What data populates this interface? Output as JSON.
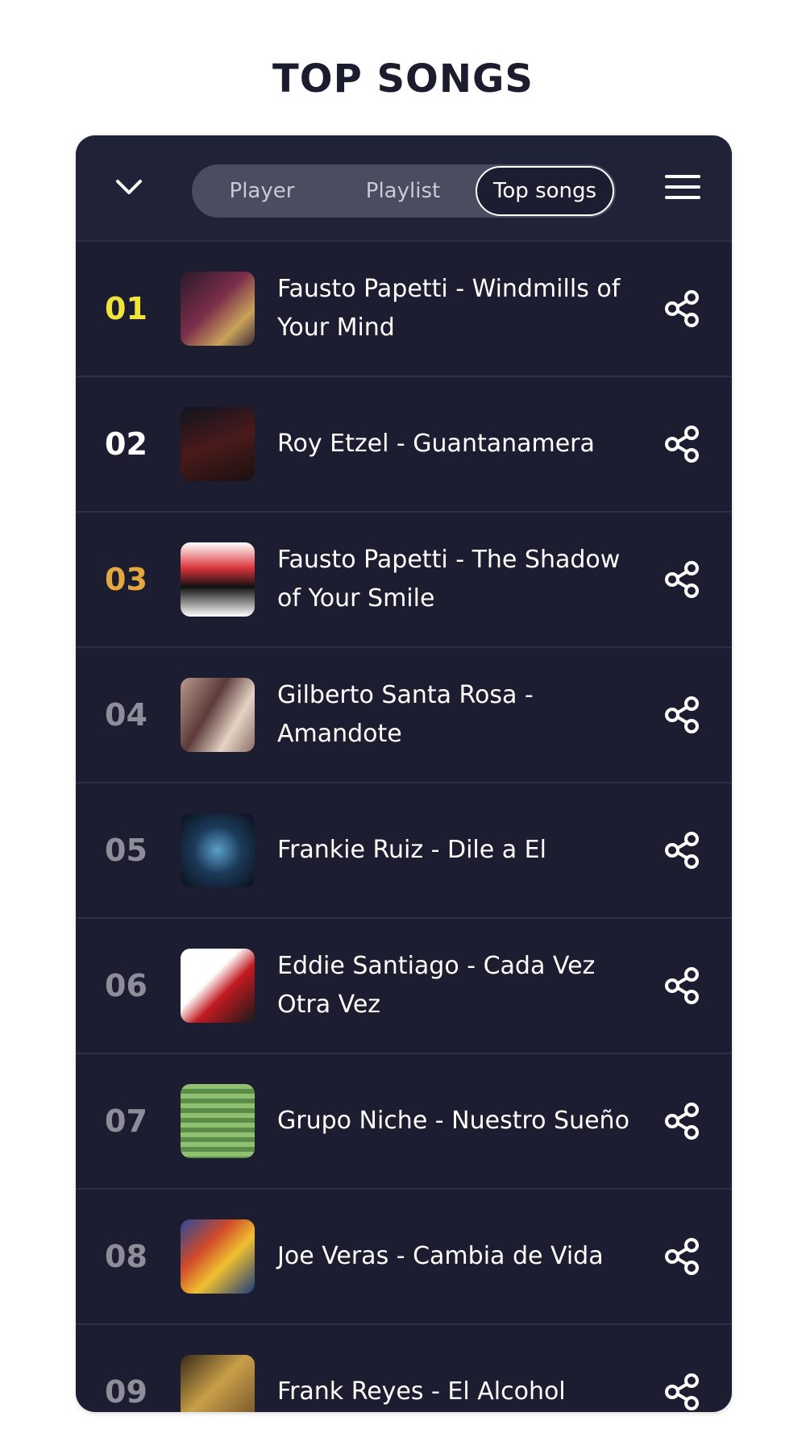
{
  "page": {
    "title": "TOP SONGS"
  },
  "header": {
    "tabs": [
      {
        "label": "Player"
      },
      {
        "label": "Playlist"
      },
      {
        "label": "Top songs"
      }
    ]
  },
  "colors": {
    "panel_bg": "#1c1d30",
    "rank_1": "#f2e33a",
    "rank_2": "#ffffff",
    "rank_3": "#e3a93f",
    "rank_other": "#8d8e99"
  },
  "songs": [
    {
      "rank": "01",
      "title": "Fausto Papetti - Windmills of Your Mind",
      "cover_icon": "album-cover-fausto-papetti-midnight"
    },
    {
      "rank": "02",
      "title": "Roy Etzel - Guantanamera",
      "cover_icon": "album-cover-trompetas-de-oro"
    },
    {
      "rank": "03",
      "title": "Fausto Papetti - The Shadow of Your Smile",
      "cover_icon": "album-cover-fausto-papetti-collection"
    },
    {
      "rank": "04",
      "title": "Gilberto Santa Rosa - Amandote",
      "cover_icon": "album-cover-esencia"
    },
    {
      "rank": "05",
      "title": "Frankie Ruiz - Dile a El",
      "cover_icon": "album-cover-radio-espacial"
    },
    {
      "rank": "06",
      "title": "Eddie Santiago - Cada Vez Otra Vez",
      "cover_icon": "album-cover-eddie-santiago-30-exitos"
    },
    {
      "rank": "07",
      "title": "Grupo Niche - Nuestro Sueño",
      "cover_icon": "album-cover-grupo-niche"
    },
    {
      "rank": "08",
      "title": "Joe Veras - Cambia de Vida",
      "cover_icon": "album-cover-bachatazo-vol-5"
    },
    {
      "rank": "09",
      "title": "Frank Reyes - El Alcohol",
      "cover_icon": "album-cover-frank-reyes"
    }
  ]
}
